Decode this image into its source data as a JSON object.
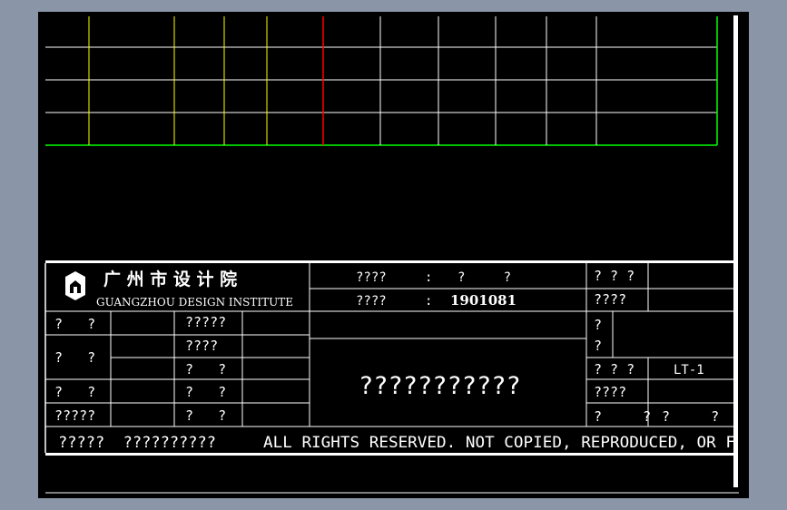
{
  "colors": {
    "background": "#000000",
    "frame": "#ffffff",
    "grid_line": "#ffffff",
    "yellow_line": "#ffff00",
    "red_line": "#ff0000",
    "green_line": "#00ff00",
    "workspace_bg": "#8a96a8"
  },
  "institute": {
    "name_cn": "广 州 市 设 计 院",
    "name_en": "GUANGZHOU DESIGN INSTITUTE",
    "logo_icon": "building-logo-icon"
  },
  "header": {
    "project_label": "????",
    "project_colon": ":",
    "project_value": "?     ?",
    "number_label": "????",
    "number_colon": ":",
    "number_value": "1901081"
  },
  "right_block": {
    "top_label_1": "? ? ?",
    "top_label_2": "????",
    "mid_label_1": "?",
    "mid_label_2": "?",
    "drawing_no_label": "? ? ?",
    "drawing_no_value": "LT-1",
    "scale_label": "????",
    "bottom_label_1": "?     ?",
    "bottom_label_2": "?     ?"
  },
  "drawing_title": "???????????",
  "sign_rows": [
    {
      "label": "?   ?",
      "role": "?????"
    },
    {
      "label": "?   ?",
      "role": "????"
    },
    {
      "label": "",
      "role": "?   ?"
    },
    {
      "label": "?   ?",
      "role": "?   ?"
    },
    {
      "label": "?????",
      "role": "?   ?"
    }
  ],
  "footer": {
    "cn_text": "?????  ??????????",
    "en_text": "ALL RIGHTS RESERVED. NOT COPIED, REPRODUCED, OR F"
  }
}
